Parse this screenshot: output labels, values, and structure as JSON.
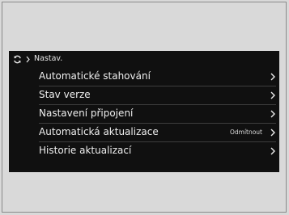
{
  "header": {
    "title": "Nastav.",
    "refresh_icon": "refresh-icon",
    "chevron_icon": "chevron-right-icon"
  },
  "menu": {
    "items": [
      {
        "label": "Automatické stahování",
        "value": ""
      },
      {
        "label": "Stav verze",
        "value": ""
      },
      {
        "label": "Nastavení připojení",
        "value": ""
      },
      {
        "label": "Automatická aktualizace",
        "value": "Odmítnout"
      },
      {
        "label": "Historie aktualizací",
        "value": ""
      }
    ]
  },
  "colors": {
    "screen_bg": "#101010",
    "page_bg": "#d9d9d9",
    "text": "#efefef",
    "divider": "#3e3e3e"
  }
}
